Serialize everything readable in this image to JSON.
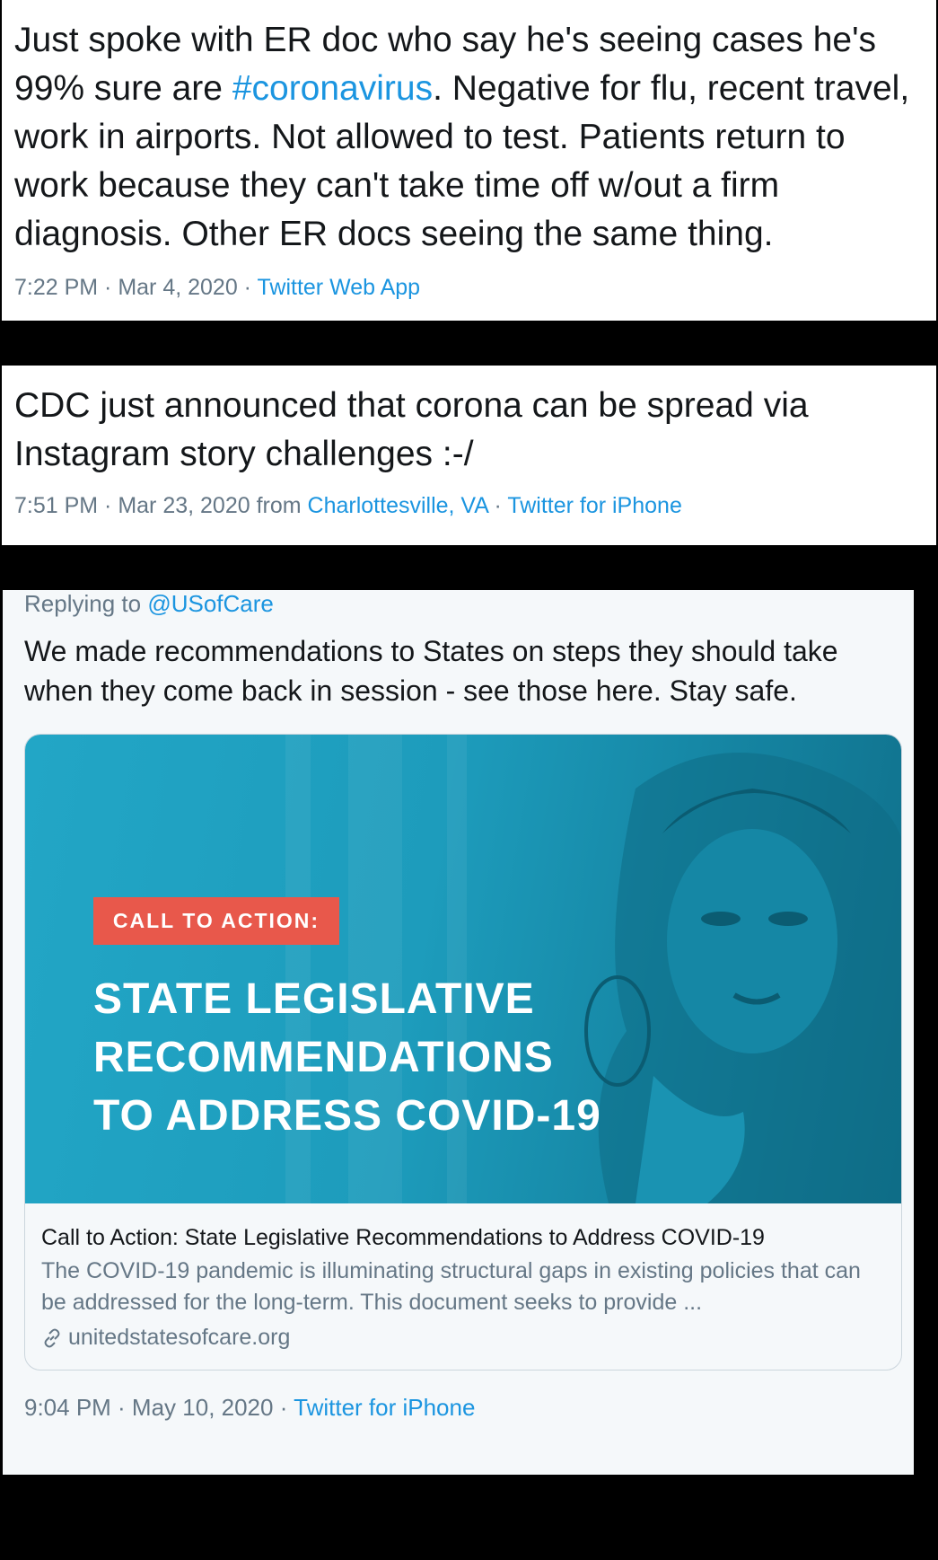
{
  "tweet1": {
    "text_before": "Just spoke with ER doc who say he's seeing cases he's 99% sure are ",
    "hashtag": "#coronavirus",
    "text_after": ". Negative for flu, recent travel, work in airports. Not allowed to test. Patients return to work because they can't take time off w/out a firm diagnosis. Other ER docs seeing the same thing.",
    "time": "7:22 PM · Mar 4, 2020 · ",
    "source": "Twitter Web App"
  },
  "tweet2": {
    "text": "CDC just announced that corona can be spread via Instagram story challenges :-/",
    "time": "7:51 PM · Mar 23, 2020 from ",
    "location": "Charlottesville, VA",
    "separator": " · ",
    "source": "Twitter for iPhone"
  },
  "tweet3": {
    "replying_prefix": "Replying to ",
    "replying_handle": "@USofCare",
    "text": "We made recommendations to States on steps they should take when they come back in session - see those here. Stay safe.",
    "card": {
      "badge": "CALL TO ACTION:",
      "headline_lines": [
        "STATE LEGISLATIVE",
        "RECOMMENDATIONS",
        "TO ADDRESS COVID-19"
      ],
      "title": "Call to Action: State Legislative Recommendations to Address COVID-19",
      "description": "The COVID-19 pandemic is illuminating structural gaps in existing policies that can be addressed for the long-term. This document seeks to provide ...",
      "domain": "unitedstatesofcare.org",
      "domain_icon": "link-icon"
    },
    "time": "9:04 PM · May 10, 2020 · ",
    "source": "Twitter for iPhone"
  },
  "colors": {
    "link": "#1b95e0",
    "meta": "#657786",
    "text": "#14171a",
    "hero": "#1d9cbc",
    "badge": "#e8584b"
  }
}
